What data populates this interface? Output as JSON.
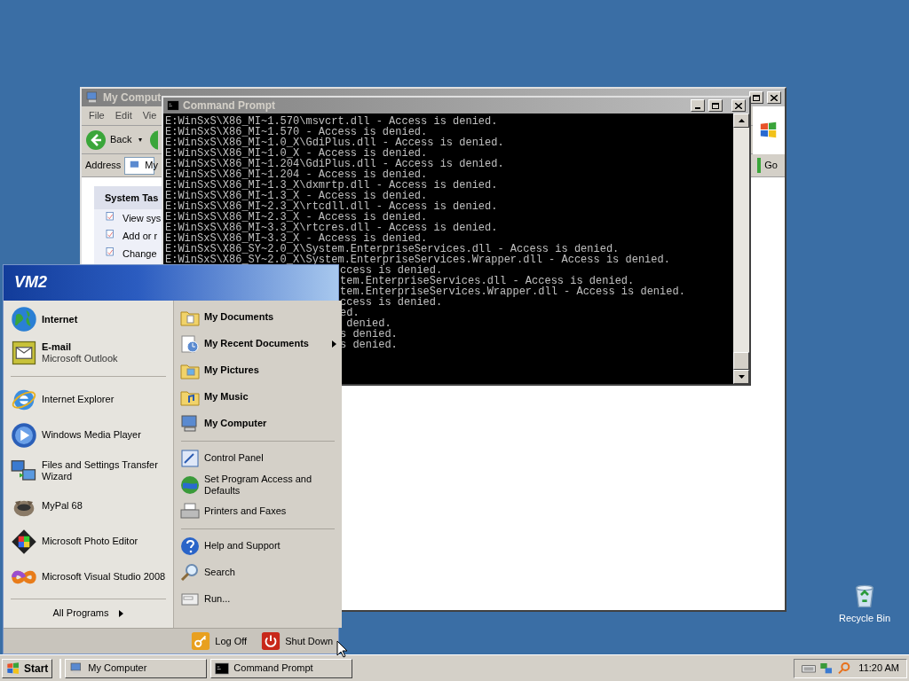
{
  "desktop": {
    "icons": [
      {
        "label": "Recycle Bin"
      }
    ]
  },
  "explorer_window": {
    "title": "My Comput",
    "menu": [
      "File",
      "Edit",
      "Vie"
    ],
    "back_button": "Back",
    "back_dropdown": "▾",
    "address_label": "Address",
    "address_value": "My",
    "go_button": "Go",
    "task_panel": {
      "title": "System Tas",
      "items": [
        "View sys",
        "Add or r",
        "Change"
      ]
    }
  },
  "command_prompt": {
    "title": "Command Prompt",
    "lines": [
      {
        "kind": "full",
        "text": "E:WinSxS\\X86_MI~1.570\\msvcrt.dll - Access is denied."
      },
      {
        "kind": "full",
        "text": "E:WinSxS\\X86_MI~1.570 - Access is denied."
      },
      {
        "kind": "full",
        "text": "E:WinSxS\\X86_MI~1.0_X\\GdiPlus.dll - Access is denied."
      },
      {
        "kind": "full",
        "text": "E:WinSxS\\X86_MI~1.0_X - Access is denied."
      },
      {
        "kind": "full",
        "text": "E:WinSxS\\X86_MI~1.204\\GdiPlus.dll - Access is denied."
      },
      {
        "kind": "full",
        "text": "E:WinSxS\\X86_MI~1.204 - Access is denied."
      },
      {
        "kind": "full",
        "text": "E:WinSxS\\X86_MI~1.3_X\\dxmrtp.dll - Access is denied."
      },
      {
        "kind": "full",
        "text": "E:WinSxS\\X86_MI~1.3_X - Access is denied."
      },
      {
        "kind": "full",
        "text": "E:WinSxS\\X86_MI~2.3_X\\rtcdll.dll - Access is denied."
      },
      {
        "kind": "full",
        "text": "E:WinSxS\\X86_MI~2.3_X - Access is denied."
      },
      {
        "kind": "full",
        "text": "E:WinSxS\\X86_MI~3.3_X\\rtcres.dll - Access is denied."
      },
      {
        "kind": "full",
        "text": "E:WinSxS\\X86_MI~3.3_X - Access is denied."
      },
      {
        "kind": "full",
        "text": "E:WinSxS\\X86_SY~2.0_X\\System.EnterpriseServices.dll - Access is denied."
      },
      {
        "kind": "full",
        "text": "E:WinSxS\\X86_SY~2.0_X\\System.EnterpriseServices.Wrapper.dll - Access is denied."
      },
      {
        "kind": "covered",
        "text": "ccess is denied."
      },
      {
        "kind": "covered",
        "text": "tem.EnterpriseServices.dll - Access is denied."
      },
      {
        "kind": "covered",
        "text": "tem.EnterpriseServices.Wrapper.dll - Access is denied."
      },
      {
        "kind": "covered",
        "text": "ccess is denied."
      },
      {
        "kind": "covered",
        "text": "ed."
      },
      {
        "kind": "covered",
        "text": " denied."
      },
      {
        "kind": "covered",
        "text": "s denied."
      },
      {
        "kind": "covered",
        "text": "s denied."
      }
    ]
  },
  "start_menu": {
    "user": "VM2",
    "pinned": [
      {
        "title": "Internet"
      },
      {
        "title": "E-mail",
        "subtitle": "Microsoft Outlook"
      }
    ],
    "recent": [
      "Internet Explorer",
      "Windows Media Player",
      "Files and Settings Transfer Wizard",
      "MyPal 68",
      "Microsoft Photo Editor",
      "Microsoft Visual Studio 2008"
    ],
    "all_programs": "All Programs",
    "places": [
      [
        {
          "label": "My Documents",
          "bold": true,
          "submenu": false
        },
        {
          "label": "My Recent Documents",
          "bold": true,
          "submenu": true
        },
        {
          "label": "My Pictures",
          "bold": true,
          "submenu": false
        },
        {
          "label": "My Music",
          "bold": true,
          "submenu": false
        },
        {
          "label": "My Computer",
          "bold": true,
          "submenu": false
        }
      ],
      [
        {
          "label": "Control Panel",
          "bold": false,
          "submenu": false
        },
        {
          "label": "Set Program Access and Defaults",
          "bold": false,
          "submenu": false
        },
        {
          "label": "Printers and Faxes",
          "bold": false,
          "submenu": false
        }
      ],
      [
        {
          "label": "Help and Support",
          "bold": false,
          "submenu": false
        },
        {
          "label": "Search",
          "bold": false,
          "submenu": false
        },
        {
          "label": "Run...",
          "bold": false,
          "submenu": false
        }
      ]
    ],
    "log_off": "Log Off",
    "shut_down": "Shut Down"
  },
  "taskbar": {
    "start": "Start",
    "tasks": [
      {
        "label": "My Computer",
        "selected": false
      },
      {
        "label": "Command Prompt",
        "selected": false
      }
    ],
    "clock": "11:20 AM"
  }
}
